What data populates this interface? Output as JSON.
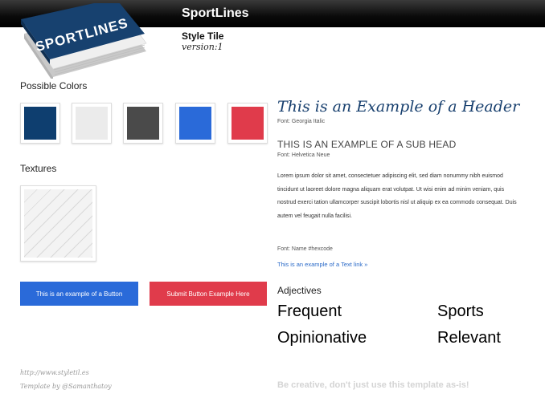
{
  "header": {
    "brand": "SportLines"
  },
  "logo": {
    "text": "SPORTLINES"
  },
  "tile": {
    "title": "Style Tile",
    "version": "version:1"
  },
  "colors": {
    "label": "Possible Colors",
    "swatches": [
      {
        "name": "navy",
        "hex": "#0e3e6f"
      },
      {
        "name": "light-gray",
        "hex": "#ebebeb"
      },
      {
        "name": "dark-gray",
        "hex": "#4a4a4a"
      },
      {
        "name": "blue",
        "hex": "#2a6ad9"
      },
      {
        "name": "red",
        "hex": "#e03b4b"
      }
    ]
  },
  "textures": {
    "label": "Textures"
  },
  "buttons": {
    "primary": {
      "label": "This is an example of a Button",
      "color": "#2a6ad9"
    },
    "submit": {
      "label": "Submit Button Example Here",
      "color": "#e03b4b"
    }
  },
  "typography": {
    "header_example": "This is an Example of a Header",
    "header_font": "Font:  Georgia Italic",
    "subhead_example": "THIS IS AN EXAMPLE OF A SUB HEAD",
    "subhead_font": "Font: Helvetica Neue",
    "body": "Lorem ipsum dolor sit amet, consectetuer adipiscing elit, sed diam nonummy nibh euismod tincidunt ut laoreet dolore magna aliquam erat volutpat. Ut wisi enim ad minim veniam, quis nostrud exerci tation ullamcorper suscipit lobortis nisl ut aliquip ex ea commodo consequat. Duis autem vel feugait nulla facilisi.",
    "font_name": "Font: Name #hexcode",
    "link": "This is an example of a Text link »"
  },
  "adjectives": {
    "label": "Adjectives",
    "items": [
      "Frequent",
      "Sports",
      "Opinionative",
      "Relevant"
    ]
  },
  "footer": {
    "url": "http://www.styletil.es",
    "credit": "Template by @Samanthatoy",
    "note": "Be creative, don't just use this template as-is!"
  }
}
